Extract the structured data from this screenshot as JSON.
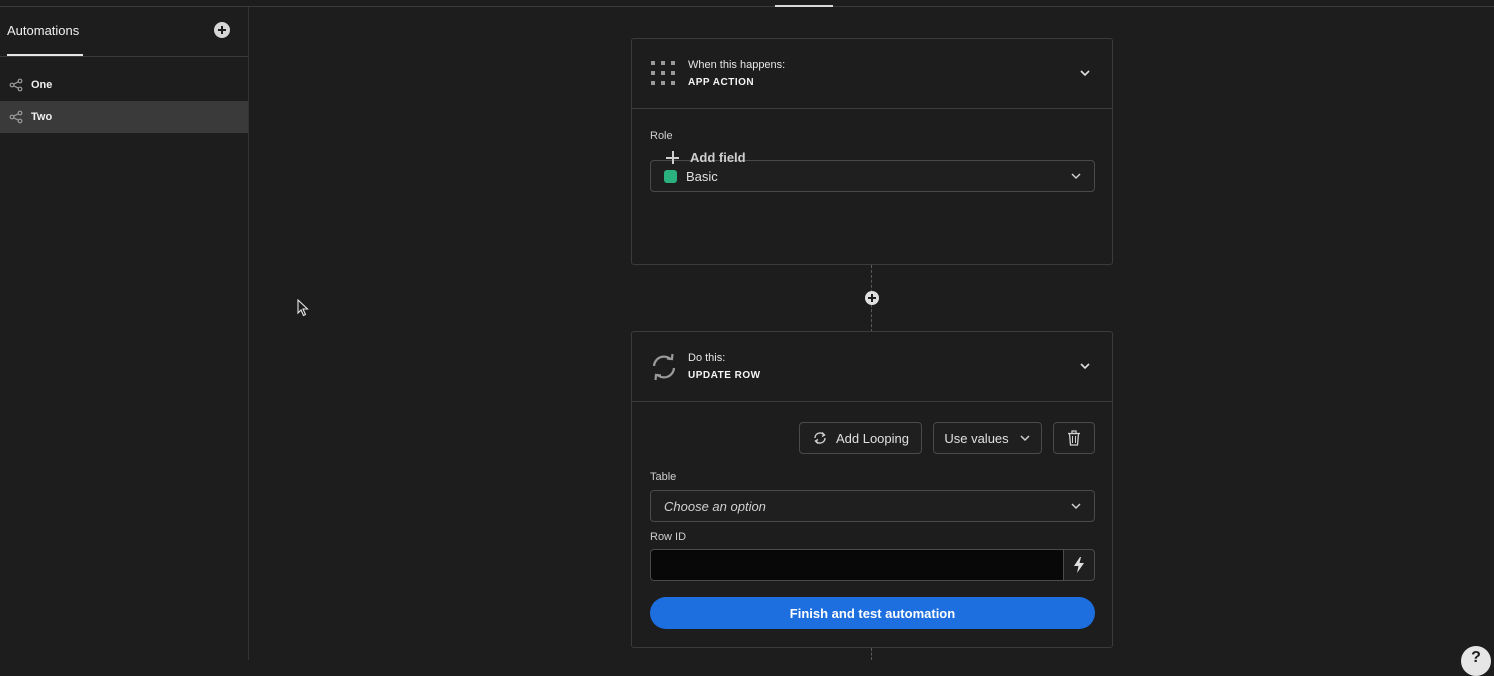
{
  "sidebar": {
    "tab_label": "Automations",
    "add_icon": "plus-circle-icon",
    "items": [
      {
        "label": "One",
        "icon": "share-icon",
        "active": false
      },
      {
        "label": "Two",
        "icon": "share-icon",
        "active": true
      }
    ]
  },
  "trigger": {
    "icon": "grid-icon",
    "subtitle": "When this happens:",
    "title": "APP ACTION",
    "role_label": "Role",
    "role_value": "Basic",
    "role_color": "#2bb07f",
    "add_field_label": "Add field"
  },
  "action": {
    "icon": "sync-icon",
    "subtitle": "Do this:",
    "title": "UPDATE ROW",
    "add_looping_label": "Add Looping",
    "use_values_label": "Use values",
    "table_label": "Table",
    "table_placeholder": "Choose an option",
    "row_id_label": "Row ID",
    "row_id_value": "",
    "finish_label": "Finish and test automation"
  },
  "colors": {
    "background": "#1d1d1d",
    "primary": "#1d6fe0",
    "active_item": "#3a3a3a"
  }
}
